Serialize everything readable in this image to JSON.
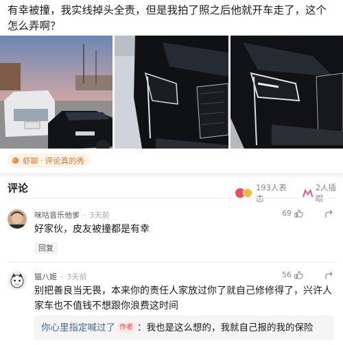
{
  "post": {
    "title": "有幸被撞，我实线掉头全责，但是我拍了照之后他就开车走了，这个怎么弄啊？"
  },
  "photos": [
    {
      "icon": "car-photo-icon"
    },
    {
      "icon": "car-photo-icon"
    },
    {
      "icon": "car-photo-icon"
    }
  ],
  "topic": {
    "brand": "虾聊",
    "sep": "·",
    "name": "评论真的秀",
    "icon": "shrimp-icon",
    "color": "#e8772c"
  },
  "comments_header": {
    "title": "评论",
    "reactions": "193人表态",
    "mirror": "2人插眼"
  },
  "comments": [
    {
      "user": "咪咕音乐他爹",
      "dot": "·",
      "time": "3天前",
      "likes": "69",
      "text": "好家伙，皮友被撞都是有幸",
      "reply_label": "回复"
    },
    {
      "user": "猫八姬",
      "dot": "·",
      "time": "3天前",
      "likes": "56",
      "text": "别把善良当无畏，本来你的责任人家放过你了就自己修修得了，兴许人家车也不值钱不想跟你浪费这时间",
      "sub_reply": {
        "user": "你心里指定喊过了",
        "badge": "作者",
        "colon": "：",
        "text": "我也是这么想的，我就自己报的我的保险"
      }
    }
  ]
}
